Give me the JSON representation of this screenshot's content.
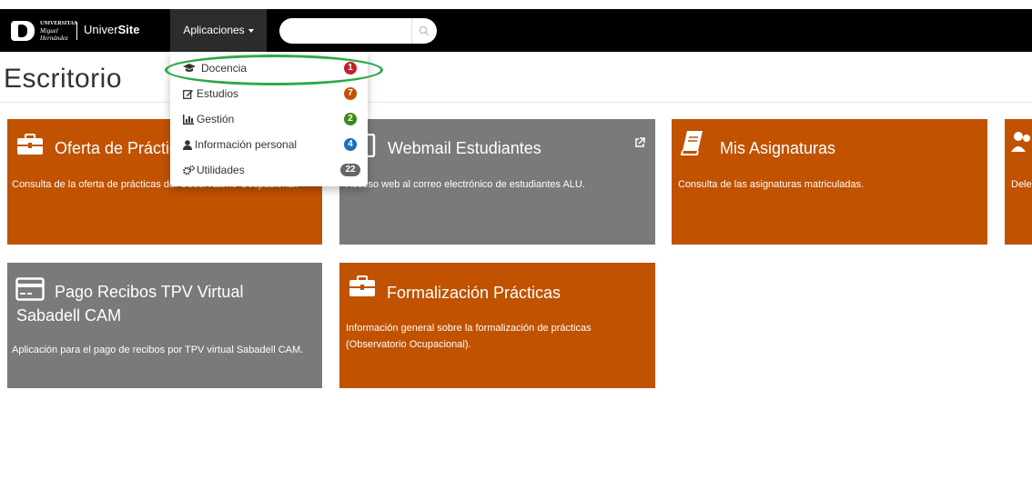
{
  "navbar": {
    "logo_lines": [
      "UNIVERSITAS",
      "Miguel",
      "Hernández"
    ],
    "brand_prefix": "Univer",
    "brand_suffix": "Site",
    "apps_label": "Aplicaciones",
    "search_placeholder": "",
    "search_icon": "search-icon",
    "background": "#000000"
  },
  "page": {
    "title": "Escritorio"
  },
  "dropdown": {
    "items": [
      {
        "label": "Docencia",
        "icon": "graduation-cap-icon",
        "badge": "1",
        "badge_color": "#c0202a"
      },
      {
        "label": "Estudios",
        "icon": "edit-icon",
        "badge": "7",
        "badge_color": "#c05200"
      },
      {
        "label": "Gestión",
        "icon": "bar-chart-icon",
        "badge": "2",
        "badge_color": "#3a8a1a"
      },
      {
        "label": "Información personal",
        "icon": "user-icon",
        "badge": "4",
        "badge_color": "#1a6fc0"
      },
      {
        "label": "Utilidades",
        "icon": "cogs-icon",
        "badge": "22",
        "badge_color": "#666666"
      }
    ],
    "highlight_color": "#2ea84a"
  },
  "tiles": [
    {
      "title": "Oferta de Prácticas",
      "description": "Consulta de la oferta de prácticas del Observatorio Ocupacional.",
      "icon": "briefcase-icon",
      "color": "#c05200"
    },
    {
      "title": "Webmail Estudiantes",
      "description": "Acceso web al correo electrónico de estudiantes ALU.",
      "icon": "mobile-icon",
      "external_icon": "external-link-icon",
      "color": "#7a7a7a"
    },
    {
      "title": "Mis Asignaturas",
      "description": "Consulta de las asignaturas matriculadas.",
      "icon": "book-icon",
      "color": "#c05200"
    },
    {
      "title": "",
      "description": "Dele",
      "icon": "users-icon",
      "color": "#c05200"
    },
    {
      "title": "Pago Recibos TPV Virtual Sabadell CAM",
      "description": "Aplicación para el pago de recibos por TPV virtual Sabadell CAM.",
      "icon": "credit-card-icon",
      "color": "#7a7a7a"
    },
    {
      "title": "Formalización Prácticas",
      "description": "Información general sobre la formalización de prácticas (Observatorio Ocupacional).",
      "icon": "briefcase-icon",
      "color": "#c05200"
    }
  ]
}
